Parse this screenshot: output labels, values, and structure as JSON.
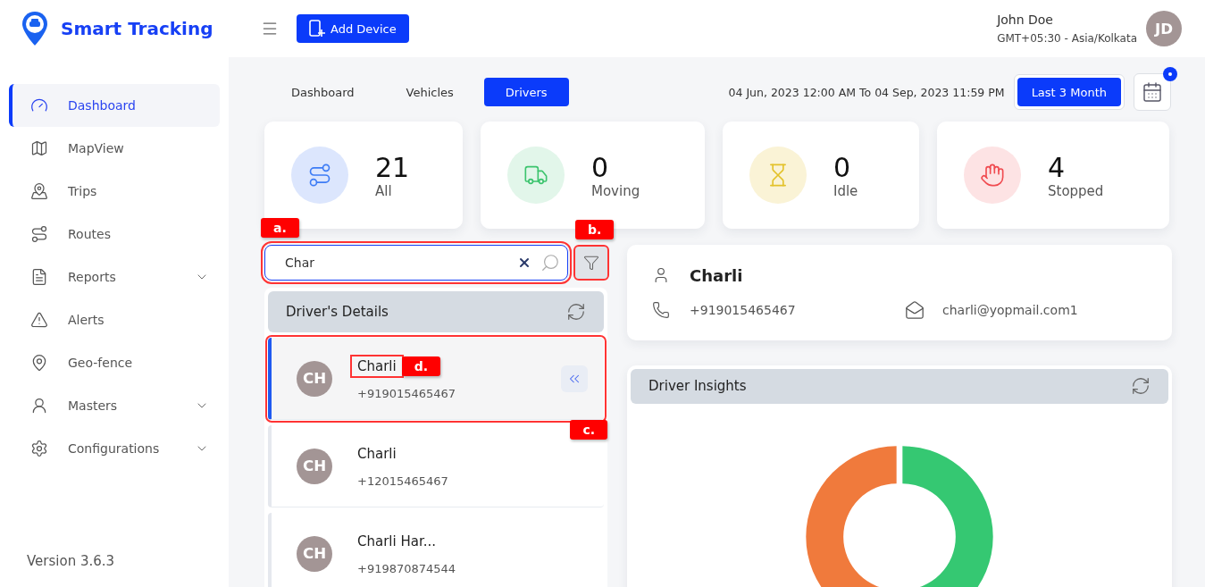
{
  "brand": {
    "name": "Smart Tracking"
  },
  "header": {
    "add_button": "Add Device",
    "user": {
      "name": "John Doe",
      "timezone": "GMT+05:30 - Asia/Kolkata",
      "initials": "JD"
    }
  },
  "sidebar": {
    "items": [
      {
        "label": "Dashboard",
        "selected": true,
        "has_submenu": false
      },
      {
        "label": "MapView",
        "selected": false,
        "has_submenu": false
      },
      {
        "label": "Trips",
        "selected": false,
        "has_submenu": false
      },
      {
        "label": "Routes",
        "selected": false,
        "has_submenu": false
      },
      {
        "label": "Reports",
        "selected": false,
        "has_submenu": true
      },
      {
        "label": "Alerts",
        "selected": false,
        "has_submenu": false
      },
      {
        "label": "Geo-fence",
        "selected": false,
        "has_submenu": false
      },
      {
        "label": "Masters",
        "selected": false,
        "has_submenu": true
      },
      {
        "label": "Configurations",
        "selected": false,
        "has_submenu": true
      }
    ],
    "version": "Version 3.6.3"
  },
  "tabs": [
    {
      "label": "Dashboard",
      "selected": false
    },
    {
      "label": "Vehicles",
      "selected": false
    },
    {
      "label": "Drivers",
      "selected": true
    }
  ],
  "date_range": {
    "text": "04 Jun, 2023 12:00 AM To 04 Sep, 2023 11:59 PM",
    "preset": "Last 3 Month",
    "notification": true
  },
  "stats": [
    {
      "value": "21",
      "label": "All",
      "kind": "route"
    },
    {
      "value": "0",
      "label": "Moving",
      "kind": "truck"
    },
    {
      "value": "0",
      "label": "Idle",
      "kind": "hourglass"
    },
    {
      "value": "4",
      "label": "Stopped",
      "kind": "hand"
    }
  ],
  "search": {
    "value": "Char",
    "callout": "a."
  },
  "filter": {
    "callout": "b."
  },
  "driver_list": {
    "title": "Driver's Details",
    "items": [
      {
        "initials": "CH",
        "name": "Charli",
        "phone": "+919015465467",
        "selected": true,
        "callout": "c.",
        "name_callout": "d."
      },
      {
        "initials": "CH",
        "name": "Charli",
        "phone": "+12015465467",
        "selected": false
      },
      {
        "initials": "CH",
        "name": "Charli Har...",
        "phone": "+919870874544",
        "selected": false
      }
    ]
  },
  "driver_card": {
    "name": "Charli",
    "phone": "+919015465467",
    "email": "charli@yopmail.com1"
  },
  "insights": {
    "title": "Driver Insights"
  }
}
